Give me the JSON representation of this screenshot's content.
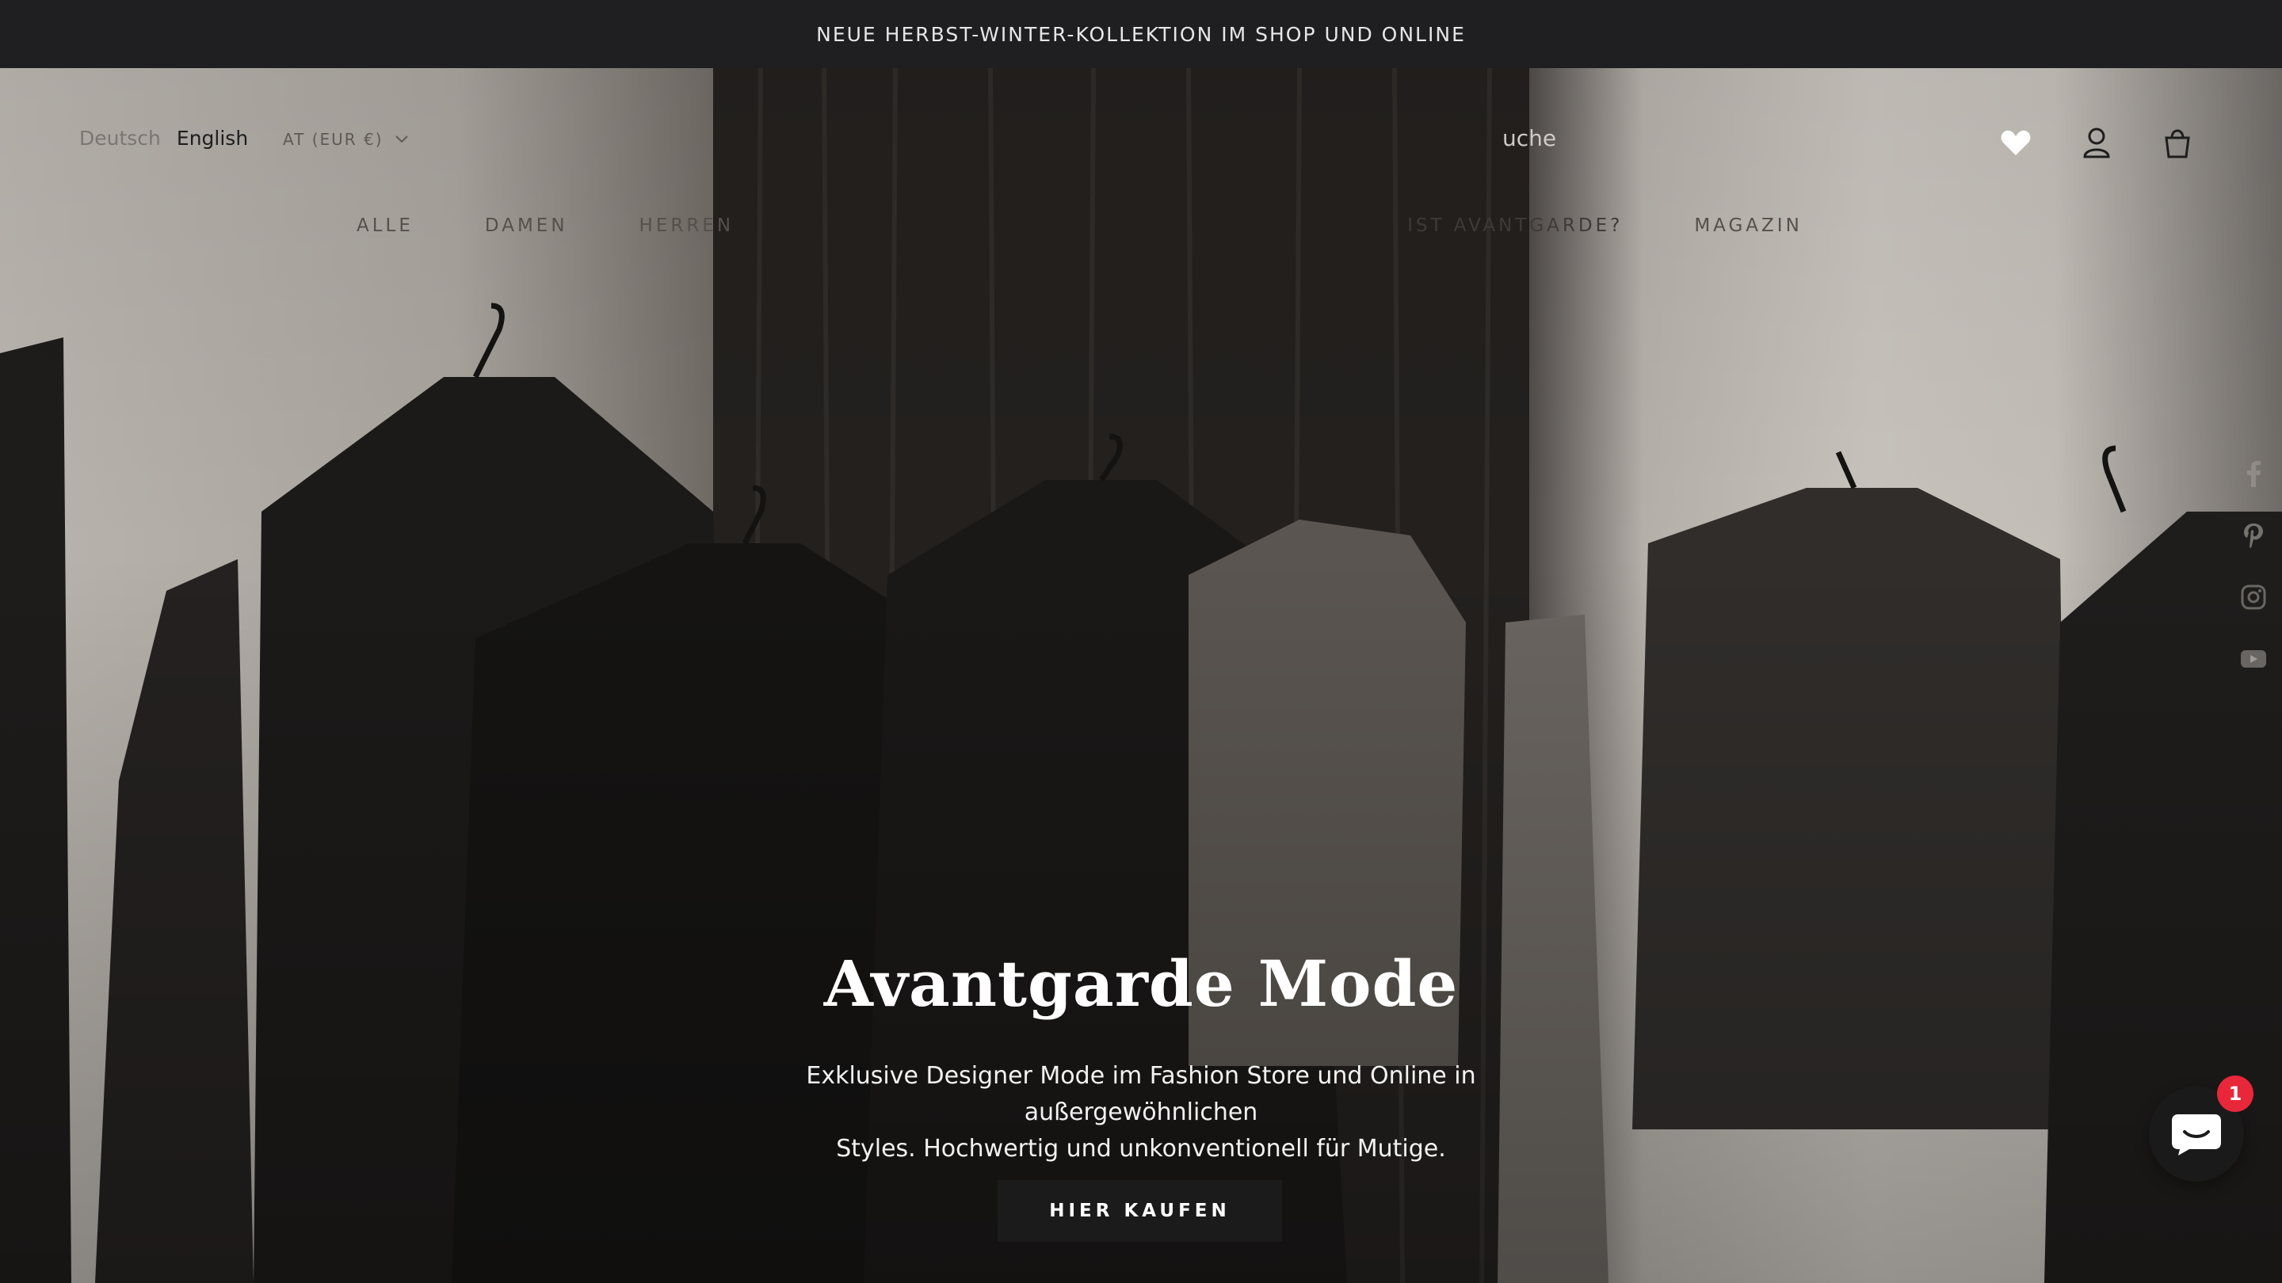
{
  "announcement": "NEUE HERBST-WINTER-KOLLEKTION IM SHOP UND ONLINE",
  "languages": [
    "Deutsch",
    "English"
  ],
  "currency": "AT (EUR €)",
  "search": {
    "placeholder": "Suche",
    "visible_text": "uche"
  },
  "nav": [
    "ALLE",
    "DAMEN",
    "HERREN",
    "IST AVANTGARDE?",
    "MAGAZIN"
  ],
  "icons": {
    "wishlist": "heart-icon",
    "account": "user-icon",
    "cart": "bag-icon",
    "social": [
      "facebook-icon",
      "pinterest-icon",
      "instagram-icon",
      "youtube-icon"
    ],
    "chat": "chat-icon"
  },
  "hero": {
    "title": "Avantgarde Mode",
    "subtitle_line1": "Exklusive Designer Mode im Fashion Store und Online in außergewöhnlichen",
    "subtitle_line2": "Styles. Hochwertig und unkonventionell für Mutige.",
    "cta": "HIER KAUFEN"
  },
  "chat_badge": "1",
  "colors": {
    "topbar": "#1f1f21",
    "cta": "#1b1b1b",
    "badge": "#e8273b"
  }
}
